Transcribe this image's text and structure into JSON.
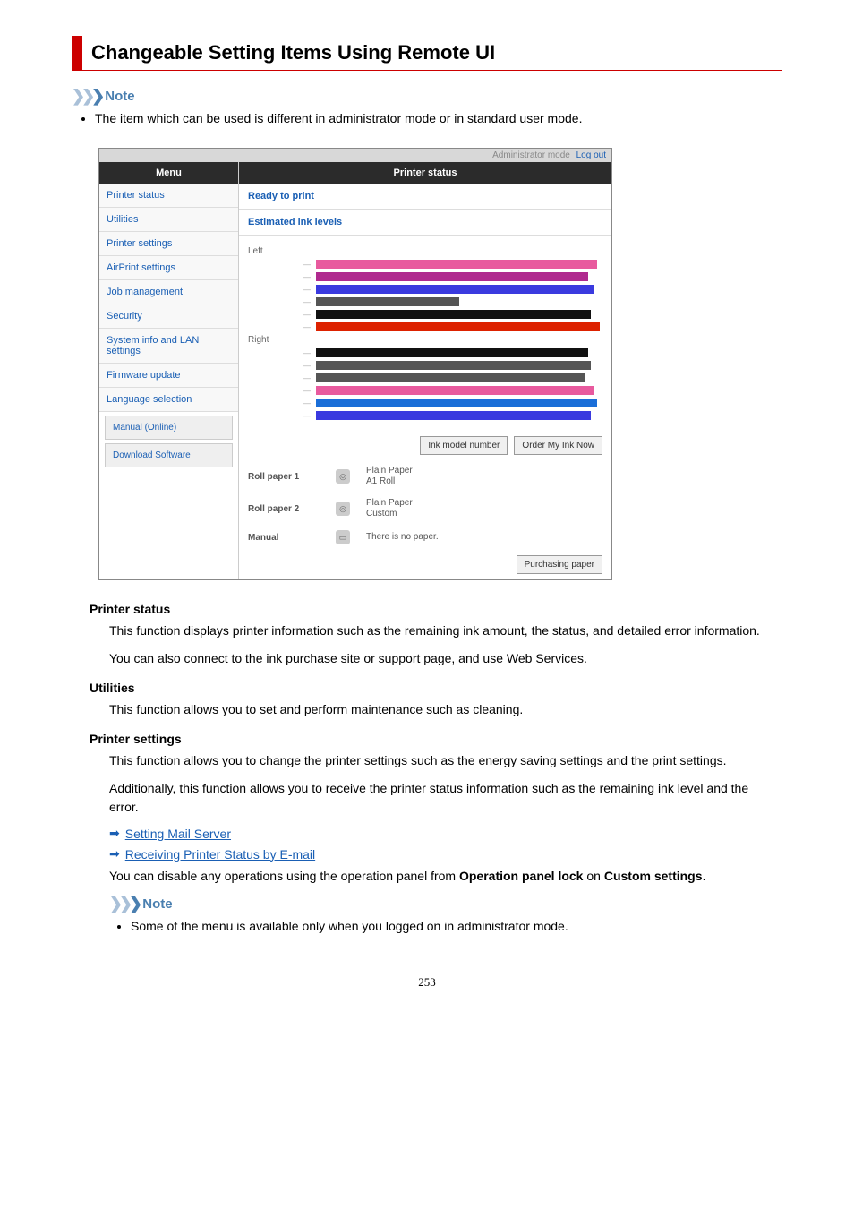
{
  "page": {
    "title": "Changeable Setting Items Using Remote UI",
    "note_label": "Note",
    "note_item": "The item which can be used is different in administrator mode or in standard user mode.",
    "page_number": "253"
  },
  "ui": {
    "top_right_mode": "Administrator mode",
    "top_right_logout": "Log out",
    "menu_header": "Menu",
    "main_header": "Printer status",
    "menu_items": [
      "Printer status",
      "Utilities",
      "Printer settings",
      "AirPrint settings",
      "Job management",
      "Security",
      "System info and LAN settings",
      "Firmware update",
      "Language selection"
    ],
    "menu_sub": [
      "Manual (Online)",
      "Download Software"
    ],
    "ready": "Ready to print",
    "levels_label": "Estimated ink levels",
    "left_label": "Left",
    "right_label": "Right",
    "btn_ink": "Ink model number",
    "btn_order": "Order My Ink Now",
    "paper1_name": "Roll paper 1",
    "paper1_desc1": "Plain Paper",
    "paper1_desc2": "A1 Roll",
    "paper2_name": "Roll paper 2",
    "paper2_desc1": "Plain Paper",
    "paper2_desc2": "Custom",
    "paper3_name": "Manual",
    "paper3_desc": "There is no paper.",
    "btn_purchase": "Purchasing paper"
  },
  "desc": {
    "printer_status_title": "Printer status",
    "printer_status_body1": "This function displays printer information such as the remaining ink amount, the status, and detailed error information.",
    "printer_status_body2": "You can also connect to the ink purchase site or support page, and use Web Services.",
    "utilities_title": "Utilities",
    "utilities_body": "This function allows you to set and perform maintenance such as cleaning.",
    "settings_title": "Printer settings",
    "settings_body1": "This function allows you to change the printer settings such as the energy saving settings and the print settings.",
    "settings_body2": "Additionally, this function allows you to receive the printer status information such as the remaining ink level and the error.",
    "link1": "Setting Mail Server",
    "link2": "Receiving Printer Status by E-mail",
    "settings_body3a": "You can disable any operations using the operation panel from ",
    "settings_body3b": "Operation panel lock",
    "settings_body3c": " on ",
    "settings_body3d": "Custom settings",
    "settings_body3e": ".",
    "sub_note_item": "Some of the menu is available only when you logged on in administrator mode."
  }
}
